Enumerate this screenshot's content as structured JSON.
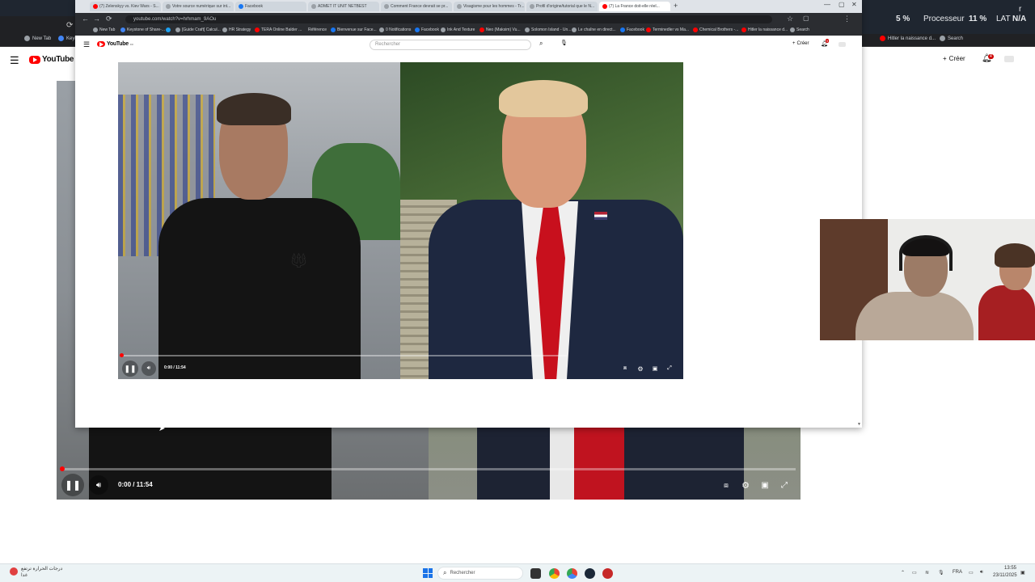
{
  "back_browser": {
    "bookmarks": [
      {
        "label": "New Tab",
        "color": "#9aa0a6"
      },
      {
        "label": "Keyi",
        "color": "#4285f4"
      }
    ],
    "bookmarks_right": [
      {
        "label": "Hitler la naissance d...",
        "color": "#ff0000"
      },
      {
        "label": "Search",
        "color": "#9aa0a6"
      }
    ],
    "system_stats": {
      "cpu_label": "5 %",
      "processor_label": "Processeur",
      "processor_value": "11 %",
      "lat_label": "LAT",
      "lat_value": "N/A",
      "corner_text": "r"
    },
    "youtube": {
      "logo_text": "YouTube",
      "logo_region": "FR",
      "create_label": "Créer",
      "notif_count": "4"
    },
    "video": {
      "time": "0:00 / 11:54"
    }
  },
  "front_browser": {
    "tabs": [
      {
        "label": "(7) Zelenskyy vs. Kiev Wars - S...",
        "color": "#ff0000",
        "active": false
      },
      {
        "label": "Votre source numérique sur int...",
        "color": "#9aa0a6",
        "active": false
      },
      {
        "label": "Facebook",
        "color": "#1877f2",
        "active": false
      },
      {
        "label": "ADMET IT UNIT NETBEST",
        "color": "#9aa0a6",
        "active": false
      },
      {
        "label": "Comment France devrait se pr...",
        "color": "#9aa0a6",
        "active": false
      },
      {
        "label": "Visagisme pour les hommes - Tr...",
        "color": "#9aa0a6",
        "active": false
      },
      {
        "label": "Profil d'origine/tutorial que le N...",
        "color": "#9aa0a6",
        "active": false
      },
      {
        "label": "(7) La France doit-elle réel...",
        "color": "#ff0000",
        "active": true
      }
    ],
    "url": "youtube.com/watch?v=hrhmam_9AOu",
    "bookmarks": [
      {
        "label": "New Tab",
        "color": "#9aa0a6"
      },
      {
        "label": "Keystone of Share-...",
        "color": "#4285f4"
      },
      {
        "label": "",
        "color": "#1da1f2"
      },
      {
        "label": "[Guide Craft] Calcul...",
        "color": "#9aa0a6"
      },
      {
        "label": "HR Strategy",
        "color": "#9aa0a6"
      },
      {
        "label": "TERA Online Balder ...",
        "color": "#ff0000"
      },
      {
        "label": "Référence",
        "color": "#9aa0a6"
      },
      {
        "label": "Bienvenue sur Face...",
        "color": "#1877f2"
      },
      {
        "label": "0 Notifications",
        "color": "#9aa0a6"
      },
      {
        "label": "Facebook",
        "color": "#1877f2"
      },
      {
        "label": "Ink And Texture",
        "color": "#9aa0a6"
      },
      {
        "label": "Neo (Maksim) Vu...",
        "color": "#ff0000"
      },
      {
        "label": "Solomon Island - Un...",
        "color": "#9aa0a6"
      },
      {
        "label": "Le chaîne en direct...",
        "color": "#9aa0a6"
      },
      {
        "label": "Facebook",
        "color": "#1877f2"
      },
      {
        "label": "Terminedler vs Ma...",
        "color": "#ff0000"
      },
      {
        "label": "Chemical Brothers -...",
        "color": "#ff0000"
      },
      {
        "label": "Hitler la naissance d...",
        "color": "#ff0000"
      },
      {
        "label": "Search",
        "color": "#9aa0a6"
      }
    ],
    "youtube": {
      "logo_text": "YouTube",
      "logo_region": "FR",
      "search_placeholder": "Rechercher",
      "create_label": "Créer",
      "notif_count": "9"
    },
    "video": {
      "time": "0:00 / 11:54"
    }
  },
  "taskbar": {
    "weather_line1": "درجات الحرارة ترتفع",
    "weather_line2": "غدا",
    "search_placeholder": "Rechercher",
    "lang": "FRA",
    "time": "13:55",
    "date": "23/11/2025"
  },
  "colors": {
    "youtube_red": "#ff0000",
    "accent": "#1a73e8"
  }
}
